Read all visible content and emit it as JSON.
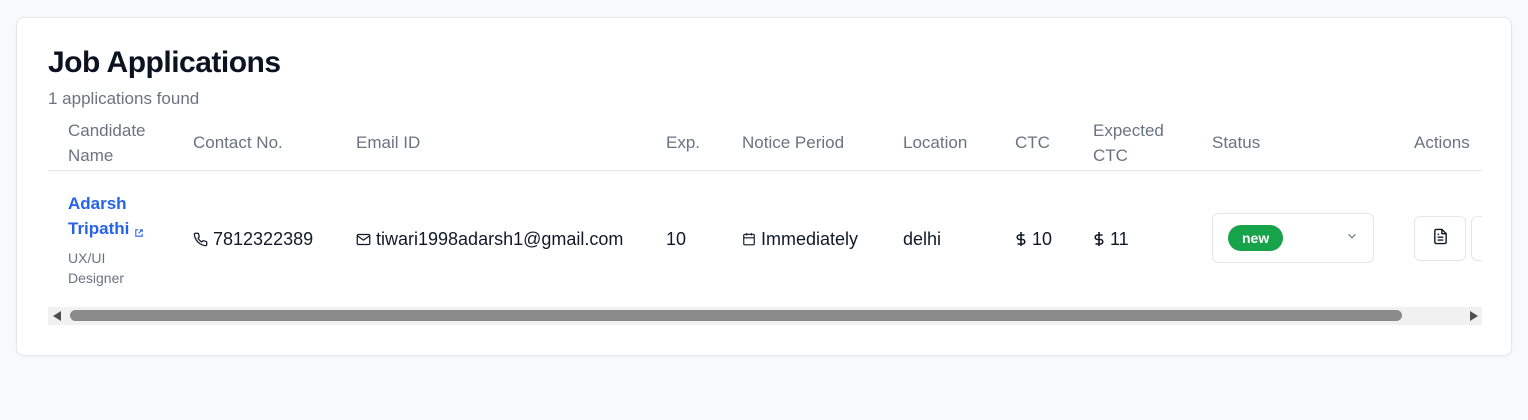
{
  "page": {
    "title": "Job Applications",
    "subtitle": "1 applications found"
  },
  "table": {
    "headers": {
      "candidate_name": "Candidate Name",
      "contact_no": "Contact No.",
      "email_id": "Email ID",
      "exp": "Exp.",
      "notice_period": "Notice Period",
      "location": "Location",
      "ctc": "CTC",
      "expected_ctc": "Expected CTC",
      "status": "Status",
      "actions": "Actions"
    },
    "rows": [
      {
        "name": "Adarsh Tripathi",
        "role": "UX/UI Designer",
        "contact": "7812322389",
        "email": "tiwari1998adarsh1@gmail.com",
        "exp": "10",
        "notice_period": "Immediately",
        "location": "delhi",
        "ctc": "10",
        "expected_ctc": "11",
        "status": "new"
      }
    ]
  },
  "icons": {
    "external_link": "external-link-icon",
    "phone": "phone-icon",
    "mail": "mail-icon",
    "calendar": "calendar-icon",
    "dollar": "dollar-icon",
    "chevron": "chevron-down-icon",
    "document": "document-icon"
  },
  "colors": {
    "accent": "#2563eb",
    "status_new": "#16a34a",
    "muted": "#6b7280",
    "border": "#e5e7eb"
  }
}
